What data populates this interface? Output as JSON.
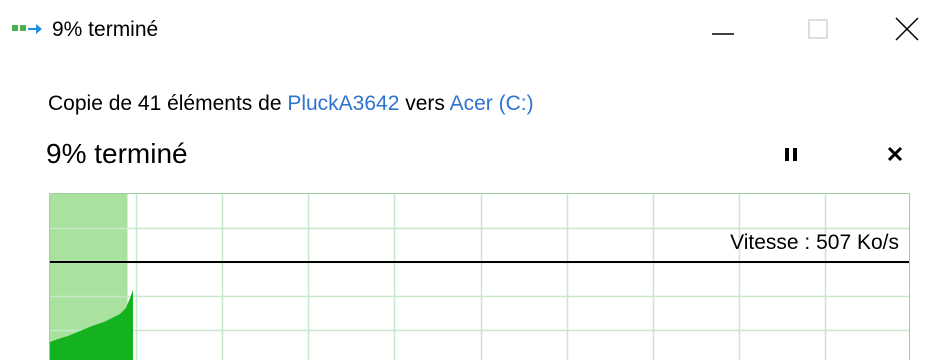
{
  "window": {
    "title": "9% terminé",
    "icon": "copy-files-icon"
  },
  "title_controls": {
    "minimize": "minimize-icon",
    "maximize": "maximize-icon",
    "close": "close-icon"
  },
  "copy": {
    "prefix": "Copie de 41 éléments de ",
    "source": "PluckA3642",
    "middle": " vers ",
    "destination": "Acer (C:)"
  },
  "progress": {
    "heading": "9% terminé",
    "percent": 9
  },
  "controls": {
    "pause": "pause-icon",
    "cancel": "cancel-icon"
  },
  "graph": {
    "speed_text": "Vitesse : 507 Ko/s",
    "colors": {
      "grid": "#c8e8cc",
      "progress_fill": "#a8e29e",
      "throughput_fill": "#14b21e",
      "speed_line": "#000000"
    }
  },
  "colors": {
    "link": "#2f74d0"
  }
}
